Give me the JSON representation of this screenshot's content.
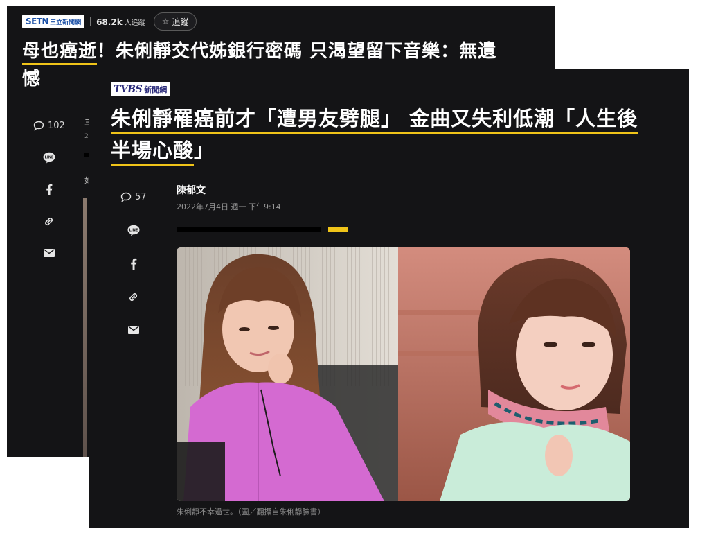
{
  "back_article": {
    "source_logo": "SETN三立新聞網",
    "followers": {
      "count": "68.2k",
      "unit": "人追蹤"
    },
    "follow_button": "追蹤",
    "title_part1": "母也癌逝",
    "title_part2": "！朱俐靜交代姊銀行密碼 只渴望留下音樂：無遺",
    "title_part3": "憾",
    "comment_count": "102",
    "icons": [
      "comment-icon",
      "line-icon",
      "facebook-icon",
      "link-icon",
      "mail-icon"
    ]
  },
  "front_article": {
    "source_logo": "TVBS新聞網",
    "title_line1": "朱俐靜罹癌前才「遭男友劈腿」 金曲又失利低潮「人生後",
    "title_line2": "半場心酸",
    "title_line2_end": "」",
    "comment_count": "57",
    "author": "陳郁文",
    "date": "2022年7月4日 週一 下午9:14",
    "photo_caption": "朱俐靜不幸過世。（圖／翻攝自朱俐靜臉書）",
    "icons": [
      "comment-icon",
      "line-icon",
      "facebook-icon",
      "link-icon",
      "mail-icon"
    ]
  },
  "colors": {
    "background": "#141416",
    "accent": "#f0c419",
    "page": "#ffffff"
  }
}
